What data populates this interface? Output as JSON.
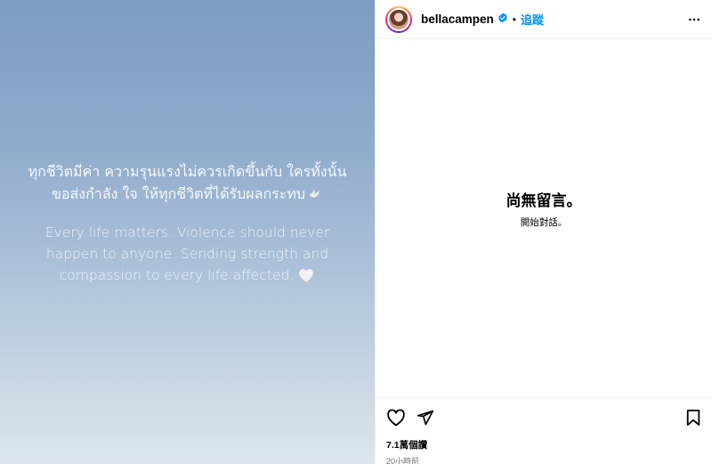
{
  "media": {
    "thai_line_1": "ทุกชีวิตมีค่า ความรุนแรงไม่ควรเกิดขึ้นกับ ใครทั้งนั้น",
    "thai_line_2": "ขอส่งกำลัง ใจ ให้ทุกชีวิตที่ได้รับผลกระทบ",
    "english_text": "Every life matters. Violence should never happen to anyone. Sending strength and compassion to every life affected.",
    "dove_icon": "dove-emoji",
    "heart_icon": "white-heart-emoji"
  },
  "header": {
    "username": "bellacampen",
    "verified": true,
    "separator": "•",
    "follow_label": "追蹤",
    "more_icon": "more-horizontal-icon"
  },
  "comments": {
    "empty_title": "尚無留言。",
    "empty_subtitle": "開始對話。"
  },
  "actions": {
    "like_icon": "heart-outline-icon",
    "share_icon": "paper-plane-icon",
    "save_icon": "bookmark-icon"
  },
  "footer": {
    "likes": "7.1萬個讚",
    "timestamp": "20小時前"
  },
  "colors": {
    "follow_blue": "#0095f6",
    "verified_blue": "#0095f6",
    "timestamp_gray": "#737373"
  }
}
